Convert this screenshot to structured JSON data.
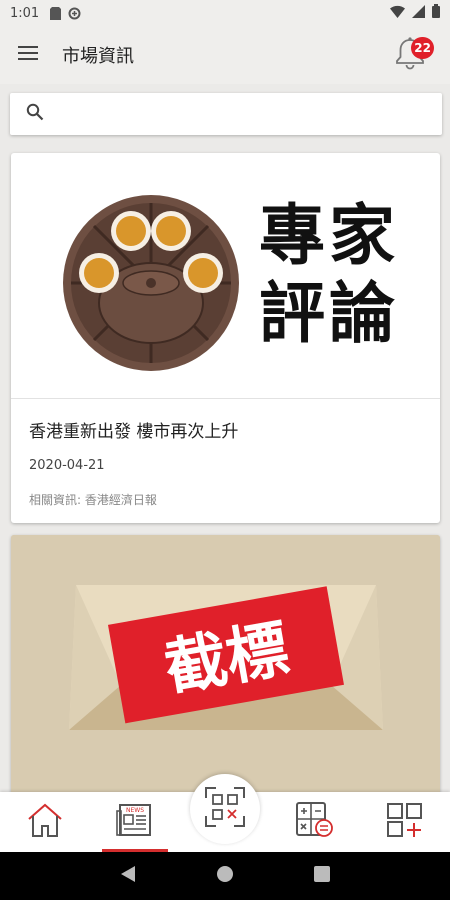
{
  "status_bar": {
    "time": "1:01"
  },
  "app_bar": {
    "title": "市場資訊",
    "notification_count": "22"
  },
  "search": {
    "placeholder": ""
  },
  "cards": [
    {
      "hero_text_line1": "專家",
      "hero_text_line2": "評論",
      "title": "香港重新出發 樓市再次上升",
      "date": "2020-04-21",
      "source": "相關資訊: 香港經濟日報"
    },
    {
      "hero_text": "截標"
    }
  ],
  "bottom_nav": {
    "items": [
      "home-icon",
      "news-icon",
      "qr-scan-icon",
      "calculator-icon",
      "more-apps-icon"
    ],
    "active": "news-icon",
    "news_label": "NEWS"
  },
  "colors": {
    "accent": "#e0202a",
    "tab_indicator": "#d42e2e"
  }
}
